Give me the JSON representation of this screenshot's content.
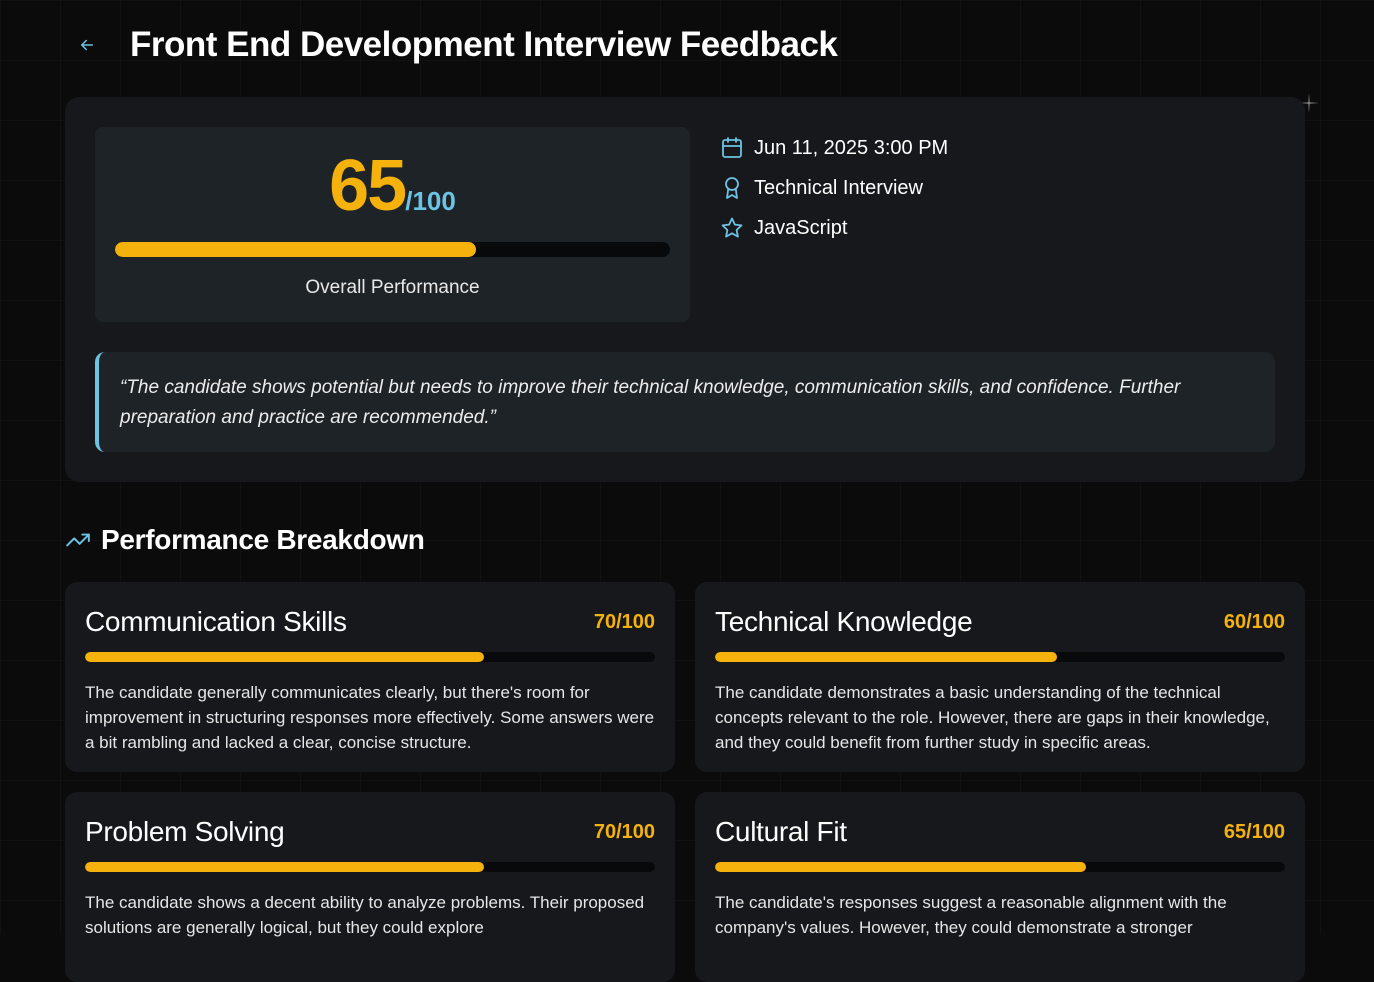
{
  "header": {
    "title": "Front End Development Interview Feedback",
    "back_icon": "arrow-left-icon"
  },
  "overall": {
    "score": "65",
    "max": "/100",
    "progress": 0.65,
    "caption": "Overall Performance"
  },
  "meta": [
    {
      "icon": "calendar-icon",
      "text": "Jun 11, 2025 3:00 PM"
    },
    {
      "icon": "award-icon",
      "text": "Technical Interview"
    },
    {
      "icon": "star-icon",
      "text": "JavaScript"
    }
  ],
  "quote": "“The candidate shows potential but needs to improve their technical knowledge, communication skills, and confidence. Further preparation and practice are recommended.”",
  "breakdown": {
    "title": "Performance Breakdown",
    "icon": "trending-up-icon",
    "items": [
      {
        "title": "Communication Skills",
        "score": "70/100",
        "progress": 0.7,
        "description": "The candidate generally communicates clearly, but there's room for improvement in structuring responses more effectively. Some answers were a bit rambling and lacked a clear, concise structure."
      },
      {
        "title": "Technical Knowledge",
        "score": "60/100",
        "progress": 0.6,
        "description": "The candidate demonstrates a basic understanding of the technical concepts relevant to the role. However, there are gaps in their knowledge, and they could benefit from further study in specific areas."
      },
      {
        "title": "Problem Solving",
        "score": "70/100",
        "progress": 0.7,
        "description": "The candidate shows a decent ability to analyze problems. Their proposed solutions are generally logical, but they could explore"
      },
      {
        "title": "Cultural Fit",
        "score": "65/100",
        "progress": 0.65,
        "description": "The candidate's responses suggest a reasonable alignment with the company's values. However, they could demonstrate a stronger"
      }
    ]
  },
  "colors": {
    "accent": "#f5b20c",
    "secondary": "#6cc3e4",
    "background": "#0b0b0c",
    "card": "#16181b"
  }
}
